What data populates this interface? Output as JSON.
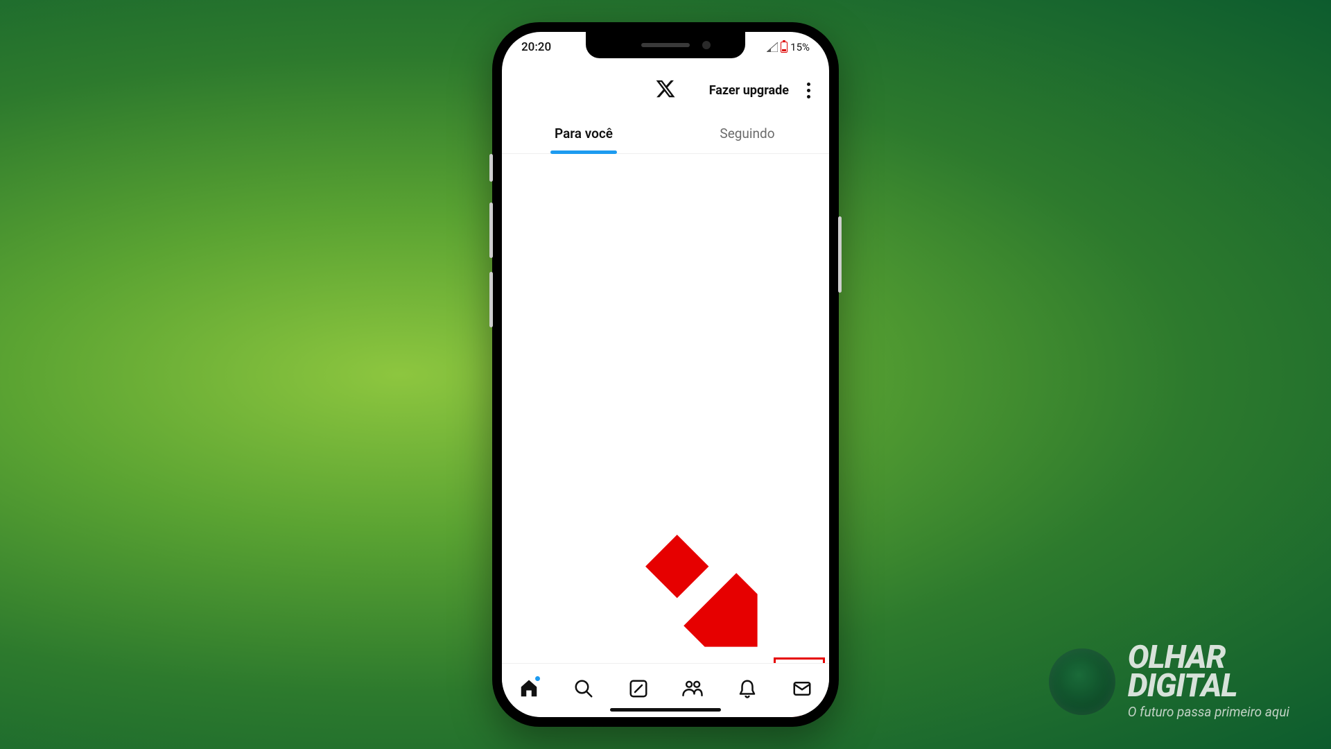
{
  "status": {
    "time": "20:20",
    "battery_pct": "15%"
  },
  "header": {
    "upgrade_label": "Fazer upgrade"
  },
  "tabs": {
    "for_you": "Para você",
    "following": "Seguindo"
  },
  "brand": {
    "name_line1": "OLHAR",
    "name_line2": "DIGITAL",
    "tagline": "O futuro passa primeiro aqui"
  }
}
